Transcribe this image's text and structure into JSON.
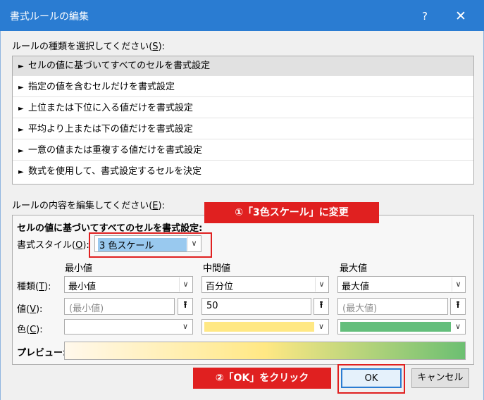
{
  "window": {
    "title": "書式ルールの編集",
    "help": "?",
    "close": "✕"
  },
  "rule_type": {
    "label_prefix": "ルールの種類を選択してください(",
    "label_key": "S",
    "label_suffix": "):",
    "items": [
      "セルの値に基づいてすべてのセルを書式設定",
      "指定の値を含むセルだけを書式設定",
      "上位または下位に入る値だけを書式設定",
      "平均より上または下の値だけを書式設定",
      "一意の値または重複する値だけを書式設定",
      "数式を使用して、書式設定するセルを決定"
    ],
    "selected_index": 0
  },
  "rule_content": {
    "label_prefix": "ルールの内容を編集してください(",
    "label_key": "E",
    "label_suffix": "):",
    "section_title": "セルの値に基づいてすべてのセルを書式設定:",
    "format_style_label_prefix": "書式スタイル(",
    "format_style_key": "O",
    "format_style_label_suffix": "):",
    "format_style_value": "3 色スケール",
    "columns": {
      "min": "最小値",
      "mid": "中間値",
      "max": "最大値"
    },
    "type_label_prefix": "種類(",
    "type_key": "T",
    "type_label_suffix": "):",
    "value_label_prefix": "値(",
    "value_key": "V",
    "value_label_suffix": "):",
    "color_label_prefix": "色(",
    "color_key": "C",
    "color_label_suffix": "):",
    "type_values": {
      "min": "最小値",
      "mid": "百分位",
      "max": "最大値"
    },
    "value_inputs": {
      "min_placeholder": "(最小値)",
      "mid_value": "50",
      "max_placeholder": "(最大値)"
    },
    "colors": {
      "min": "#ffffff",
      "mid": "#ffe884",
      "max": "#63be7b"
    },
    "preview_label": "プレビュー:"
  },
  "callouts": {
    "step1": "①「3色スケール」に変更",
    "step2": "②「OK」をクリック"
  },
  "buttons": {
    "ok": "OK",
    "cancel": "キャンセル"
  }
}
